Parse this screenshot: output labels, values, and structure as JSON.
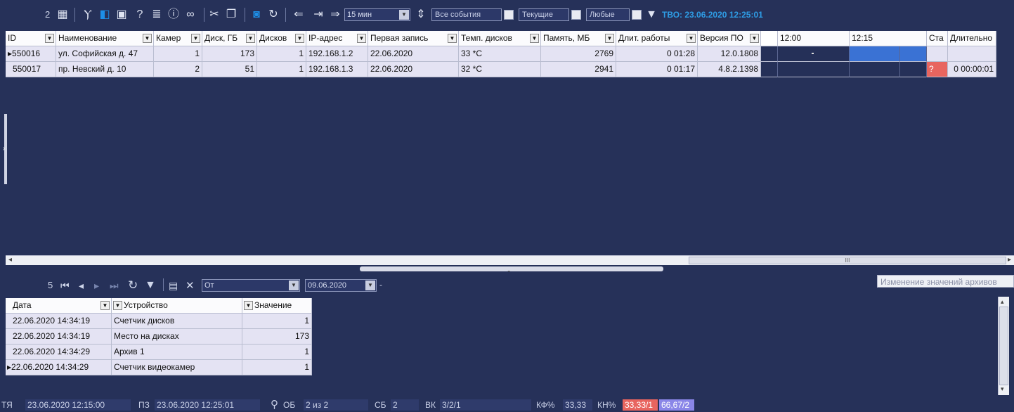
{
  "toolbar": {
    "count": "2",
    "period": "15 мин",
    "all_events": "Все события",
    "current": "Текущие",
    "any": "Любые",
    "tvo": "ТВО: 23.06.2020 12:25:01"
  },
  "grid": {
    "columns": [
      "ID",
      "Наименование",
      "Камер",
      "Диск, ГБ",
      "Дисков",
      "IP-адрес",
      "Первая запись",
      "Темп. дисков",
      "Память, МБ",
      "Длит. работы",
      "Версия ПО"
    ],
    "time_cols": [
      "12:00",
      "12:15"
    ],
    "extra_cols": [
      "Ста",
      "Длительно"
    ],
    "rows": [
      {
        "id": "550016",
        "name": "ул. Софийская д. 47",
        "cams": "1",
        "disk": "173",
        "disks": "1",
        "ip": "192.168.1.2",
        "first": "22.06.2020",
        "temp": "33 *C",
        "mem": "2769",
        "uptime": "0 01:28",
        "ver": "12.0.1808",
        "status": "",
        "dur": ""
      },
      {
        "id": "550017",
        "name": "пр. Невский д. 10",
        "cams": "2",
        "disk": "51",
        "disks": "1",
        "ip": "192.168.1.3",
        "first": "22.06.2020",
        "temp": "32 *C",
        "mem": "2941",
        "uptime": "0 01:17",
        "ver": "4.8.2.1398",
        "status": "?",
        "dur": "0 00:00:01"
      }
    ]
  },
  "hscroll": {
    "thumb_label": "III"
  },
  "bottom_toolbar": {
    "count": "5",
    "from_label": "От",
    "from_date": "09.06.2020",
    "dash": "-",
    "tooltip": "Изменение значений архивов"
  },
  "lower": {
    "columns": [
      "Дата",
      "Устройство",
      "Значение"
    ],
    "rows": [
      {
        "date": "22.06.2020 14:34:19",
        "device": "Счетчик дисков",
        "value": "1"
      },
      {
        "date": "22.06.2020 14:34:19",
        "device": "Место на дисках",
        "value": "173"
      },
      {
        "date": "22.06.2020 14:34:29",
        "device": "Архив 1",
        "value": "1"
      },
      {
        "date": "22.06.2020 14:34:29",
        "device": "Счетчик видеокамер",
        "value": "1"
      }
    ]
  },
  "status": {
    "tya_label": "ТЯ",
    "tya": "23.06.2020 12:15:00",
    "pz_label": "ПЗ",
    "pz": "23.06.2020 12:25:01",
    "ob_label": "ОБ",
    "ob": "2 из 2",
    "sb_label": "СБ",
    "sb": "2",
    "vk_label": "ВК",
    "vk": "3/2/1",
    "kf_label": "КФ%",
    "kf": "33,33",
    "kn_label": "КН%",
    "kn1": "33,33/1",
    "kn2": "66,67/2"
  },
  "colors": {
    "background": "#263159",
    "accent": "#2e9de6",
    "alarm": "#e8655f",
    "kn2": "#8a86e8"
  }
}
